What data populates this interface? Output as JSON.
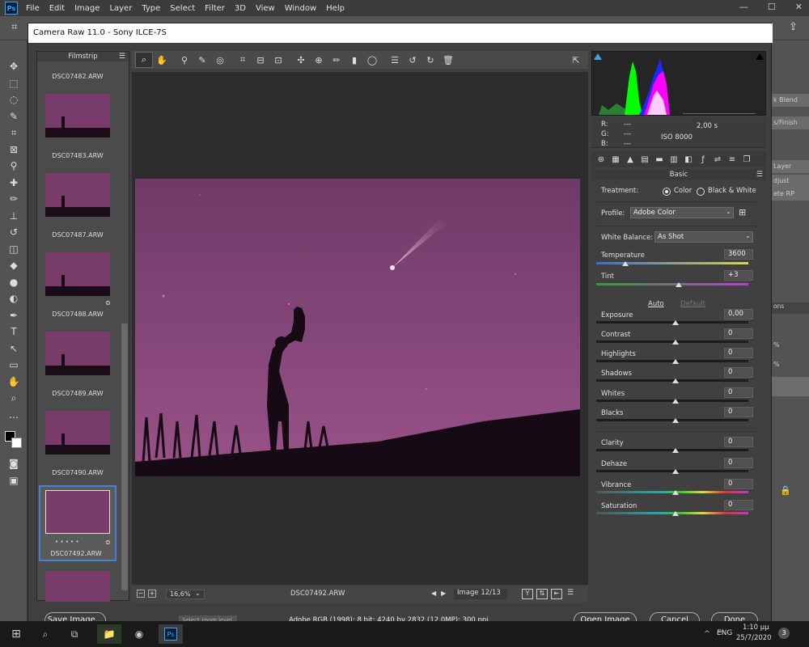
{
  "menu": [
    "File",
    "Edit",
    "Image",
    "Layer",
    "Type",
    "Select",
    "Filter",
    "3D",
    "View",
    "Window",
    "Help"
  ],
  "window_controls": [
    "—",
    "☐",
    "✕"
  ],
  "cr": {
    "title": "Camera Raw 11.0  -  Sony ILCE-7S",
    "filmstrip_title": "Filmstrip",
    "files": [
      "DSC07482.ARW",
      "DSC07483.ARW",
      "DSC07487.ARW",
      "DSC07488.ARW",
      "DSC07489.ARW",
      "DSC07490.ARW",
      "DSC07492.ARW"
    ],
    "rating_dots": "• • • • •",
    "zoom": "16,6%",
    "zoom_tooltip": "Select zoom level",
    "current_file": "DSC07492.ARW",
    "image_counter": "Image 12/13",
    "readout": {
      "r_label": "R:",
      "g_label": "G:",
      "b_label": "B:",
      "r": "---",
      "g": "---",
      "b": "---",
      "shutter": "2,00 s",
      "iso": "ISO 8000"
    },
    "panel_title": "Basic",
    "treatment_label": "Treatment:",
    "treatment_color": "Color",
    "treatment_bw": "Black & White",
    "profile_label": "Profile:",
    "profile_value": "Adobe Color",
    "wb_label": "White Balance:",
    "wb_value": "As Shot",
    "auto": "Auto",
    "default": "Default",
    "sliders": [
      {
        "label": "Temperature",
        "value": "3600"
      },
      {
        "label": "Tint",
        "value": "+3"
      },
      {
        "label": "Exposure",
        "value": "0,00"
      },
      {
        "label": "Contrast",
        "value": "0"
      },
      {
        "label": "Highlights",
        "value": "0"
      },
      {
        "label": "Shadows",
        "value": "0"
      },
      {
        "label": "Whites",
        "value": "0"
      },
      {
        "label": "Blacks",
        "value": "0"
      },
      {
        "label": "Clarity",
        "value": "0"
      },
      {
        "label": "Dehaze",
        "value": "0"
      },
      {
        "label": "Vibrance",
        "value": "0"
      },
      {
        "label": "Saturation",
        "value": "0"
      }
    ],
    "save_button": "Save Image...",
    "workflow_link": "Adobe RGB (1998); 8 bit; 4240 by 2832 (12,0MP); 300 ppi",
    "open_button": "Open Image",
    "cancel_button": "Cancel",
    "done_button": "Done"
  },
  "ps_right": [
    "k Blend",
    "s/Finish",
    "Layer",
    "djust",
    "ete RP",
    "ons",
    "%",
    "%"
  ],
  "taskbar": {
    "lang": "ENG",
    "time": "1:10 μμ",
    "date": "25/7/2020",
    "notif": "3"
  },
  "colors": {
    "accent": "#4a7fd1",
    "photo": "#8a4b7d"
  }
}
